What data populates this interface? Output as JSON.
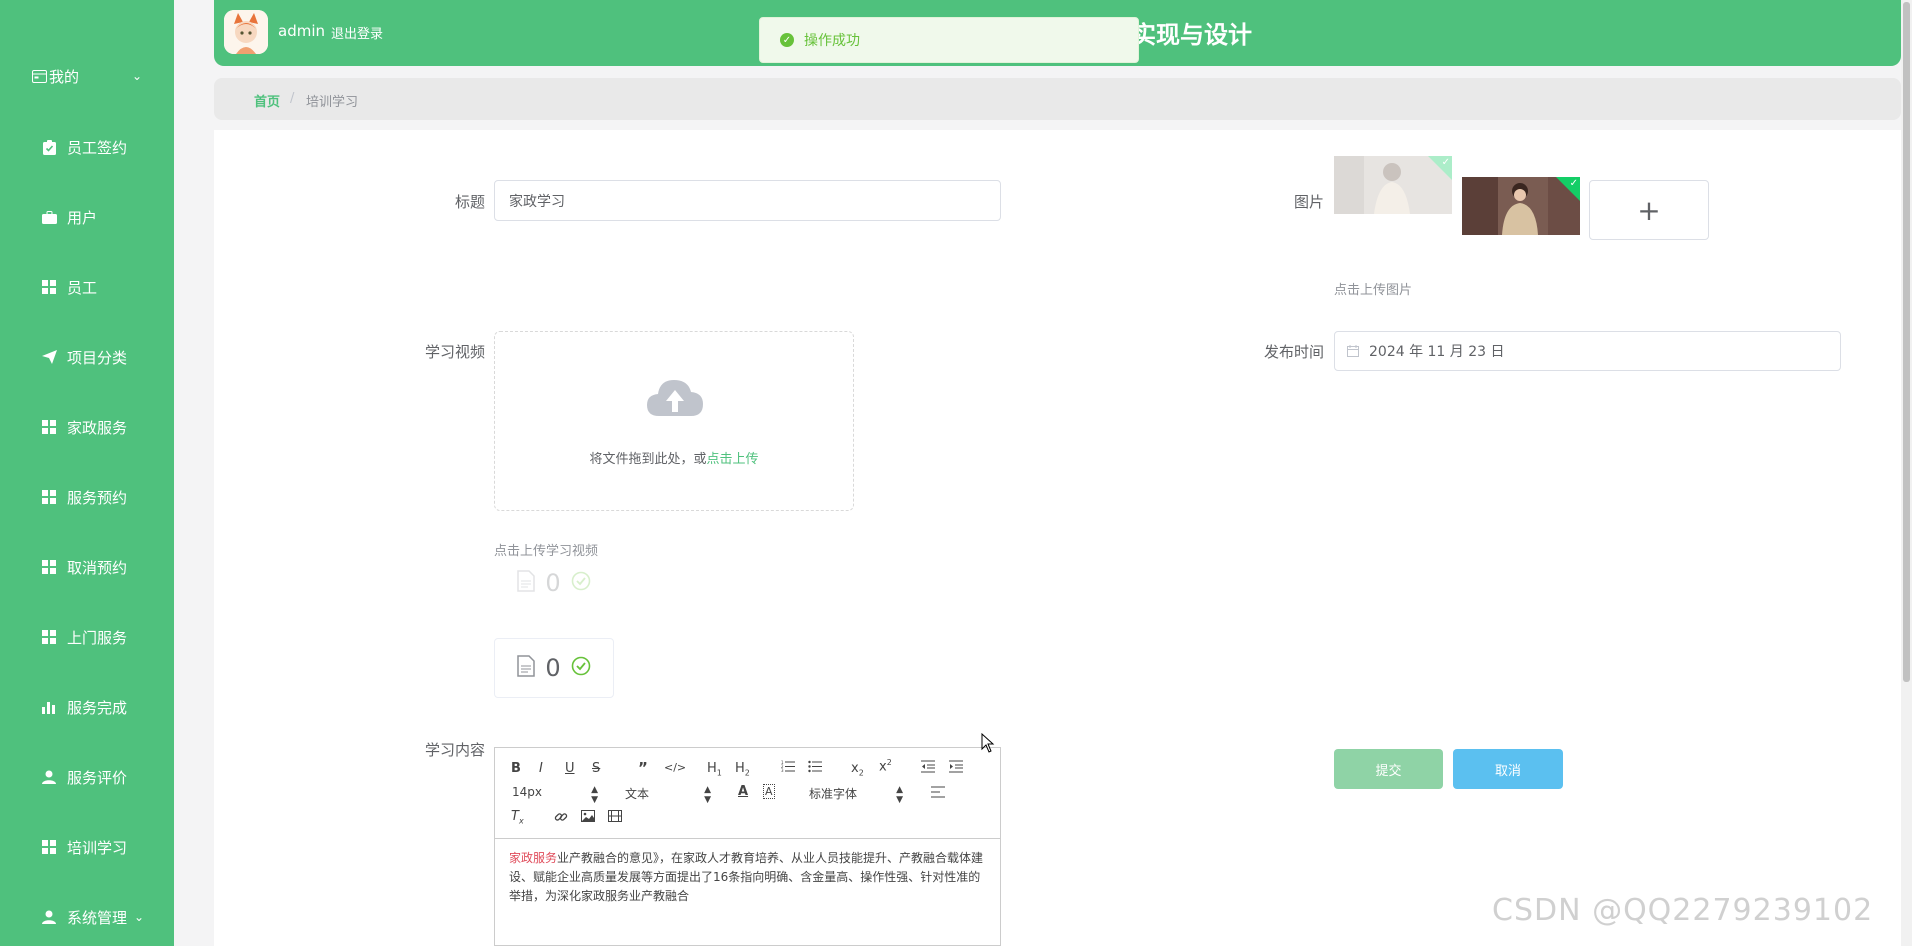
{
  "sidebar": {
    "items": [
      {
        "label": "我的",
        "icon": "wallet-icon",
        "caret": "chevron-down-icon"
      },
      {
        "label": "员工签约",
        "icon": "clipboard-icon"
      },
      {
        "label": "用户",
        "icon": "briefcase-icon"
      },
      {
        "label": "员工",
        "icon": "grid-icon"
      },
      {
        "label": "项目分类",
        "icon": "paper-plane-icon"
      },
      {
        "label": "家政服务",
        "icon": "grid-icon"
      },
      {
        "label": "服务预约",
        "icon": "grid-icon"
      },
      {
        "label": "取消预约",
        "icon": "grid-icon"
      },
      {
        "label": "上门服务",
        "icon": "grid-icon"
      },
      {
        "label": "服务完成",
        "icon": "bar-chart-icon"
      },
      {
        "label": "服务评价",
        "icon": "user-icon"
      },
      {
        "label": "培训学习",
        "icon": "grid-icon"
      },
      {
        "label": "系统管理",
        "icon": "user-icon",
        "caret": "chevron-down-icon"
      }
    ]
  },
  "header": {
    "username": "admin",
    "logout": "退出登录",
    "title_visible": "实现与设计"
  },
  "toast": {
    "message": "操作成功"
  },
  "breadcrumb": {
    "home": "首页",
    "separator": "/",
    "current": "培训学习"
  },
  "form": {
    "title_label": "标题",
    "title_value": "家政学习",
    "image_label": "图片",
    "image_hint": "点击上传图片",
    "video_label": "学习视频",
    "upload_text": "将文件拖到此处，或",
    "upload_link": "点击上传",
    "video_hint": "点击上传学习视频",
    "file_count_faded": "0",
    "file_count": "0",
    "publish_label": "发布时间",
    "publish_value": "2024 年 11 月 23 日",
    "content_label": "学习内容",
    "editor": {
      "font_size": "14px",
      "block_type": "文本",
      "font_family": "标准字体",
      "text_highlight": "家政服务",
      "text_rest": "业产教融合的意见》，在家政人才教育培养、从业人员技能提升、产教融合载体建设、赋能企业高质量发展等方面提出了16条指向明确、含金量高、操作性强、针对性准的举措，为深化家政服务业产教融合"
    },
    "submit_label": "提交",
    "cancel_label": "取消"
  },
  "colors": {
    "brand_green": "#4fc17d",
    "submit_bg": "#8fd3a6",
    "cancel_bg": "#5bc0f0",
    "success": "#67c23a"
  },
  "watermark": "CSDN @QQ2279239102"
}
